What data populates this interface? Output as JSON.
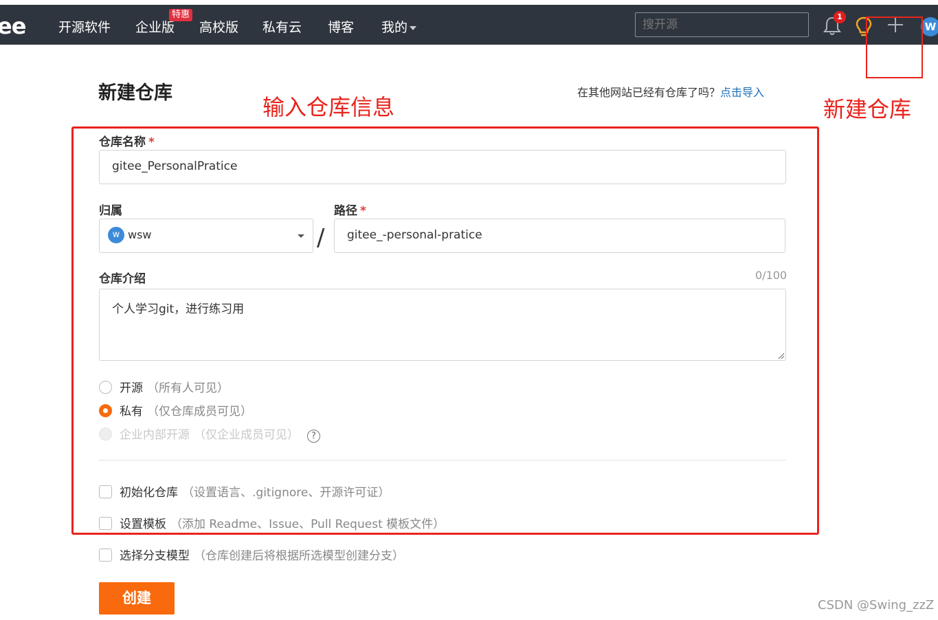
{
  "nav": {
    "logo": "ee",
    "items": [
      "开源软件",
      "企业版",
      "高校版",
      "私有云",
      "博客",
      "我的"
    ],
    "enterprise_badge": "特惠",
    "search_placeholder": "搜开源",
    "notification_count": "1",
    "avatar_letter": "W"
  },
  "annotations": {
    "form_note": "输入仓库信息",
    "plus_note": "新建仓库"
  },
  "page": {
    "title": "新建仓库",
    "import_hint": "在其他网站已经有仓库了吗？",
    "import_link": "点击导入"
  },
  "form": {
    "name_label": "仓库名称",
    "required_mark": "*",
    "name_value": "gitee_PersonalPratice",
    "owner_label": "归属",
    "owner_avatar": "w",
    "owner_value": "wsw",
    "path_separator": "/",
    "path_label": "路径",
    "path_value": "gitee_-personal-pratice",
    "desc_label": "仓库介绍",
    "desc_counter": "0/100",
    "desc_value": "个人学习git，进行练习用",
    "visibility": [
      {
        "label": "开源",
        "note": "（所有人可见）",
        "state": "unchecked"
      },
      {
        "label": "私有",
        "note": "（仅仓库成员可见）",
        "state": "checked"
      },
      {
        "label": "企业内部开源",
        "note": "（仅企业成员可见）",
        "state": "disabled"
      }
    ],
    "help_glyph": "?",
    "checkboxes": [
      {
        "label": "初始化仓库",
        "note": "（设置语言、.gitignore、开源许可证）"
      },
      {
        "label": "设置模板",
        "note": "（添加 Readme、Issue、Pull Request 模板文件）"
      },
      {
        "label": "选择分支模型",
        "note": "（仓库创建后将根据所选模型创建分支）"
      }
    ],
    "submit_label": "创建"
  },
  "watermark": "CSDN @Swing_zzZ"
}
